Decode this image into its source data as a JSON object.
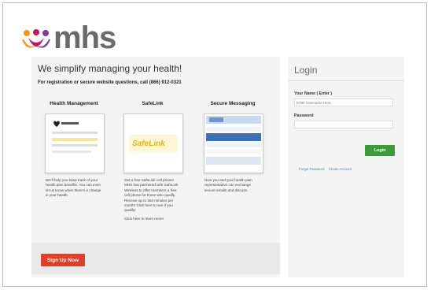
{
  "brand": {
    "logo_text": "mhs",
    "colors": {
      "orange": "#f7941d",
      "magenta": "#c2185b",
      "purple": "#7a3f98",
      "gray": "#6a6a6a"
    }
  },
  "main": {
    "headline": "We simplify managing your health!",
    "subline": "For registration or secure website questions, call (866) 912-0321",
    "columns": [
      {
        "title": "Health Management",
        "thumb_icon": "health-page-icon",
        "description": "We'll help you keep track of your health plan benefits. You can even let us know when there's a change in your health."
      },
      {
        "title": "SafeLink",
        "thumb_icon": "safelink-logo",
        "thumb_text": "SafeLink",
        "description": "Get a free SafeLink cell phone! MHS has partnered with SafeLink Wireless to offer members a free cell phone for those who qualify. Receive up to 350 minutes per month! Click here to see if you qualify!",
        "link_line": "Click here to learn more!"
      },
      {
        "title": "Secure Messaging",
        "thumb_icon": "messaging-window-icon",
        "description": "Now you and your health plan representative can exchange secure emails and discuss."
      }
    ],
    "signup_label": "Sign Up Now"
  },
  "login": {
    "title": "Login",
    "username_label": "Your Name ( Enter )",
    "username_placeholder": "Enter Username Here",
    "password_label": "Password",
    "button_label": "Login",
    "links": [
      "Forgot Password",
      "Create Account"
    ]
  }
}
